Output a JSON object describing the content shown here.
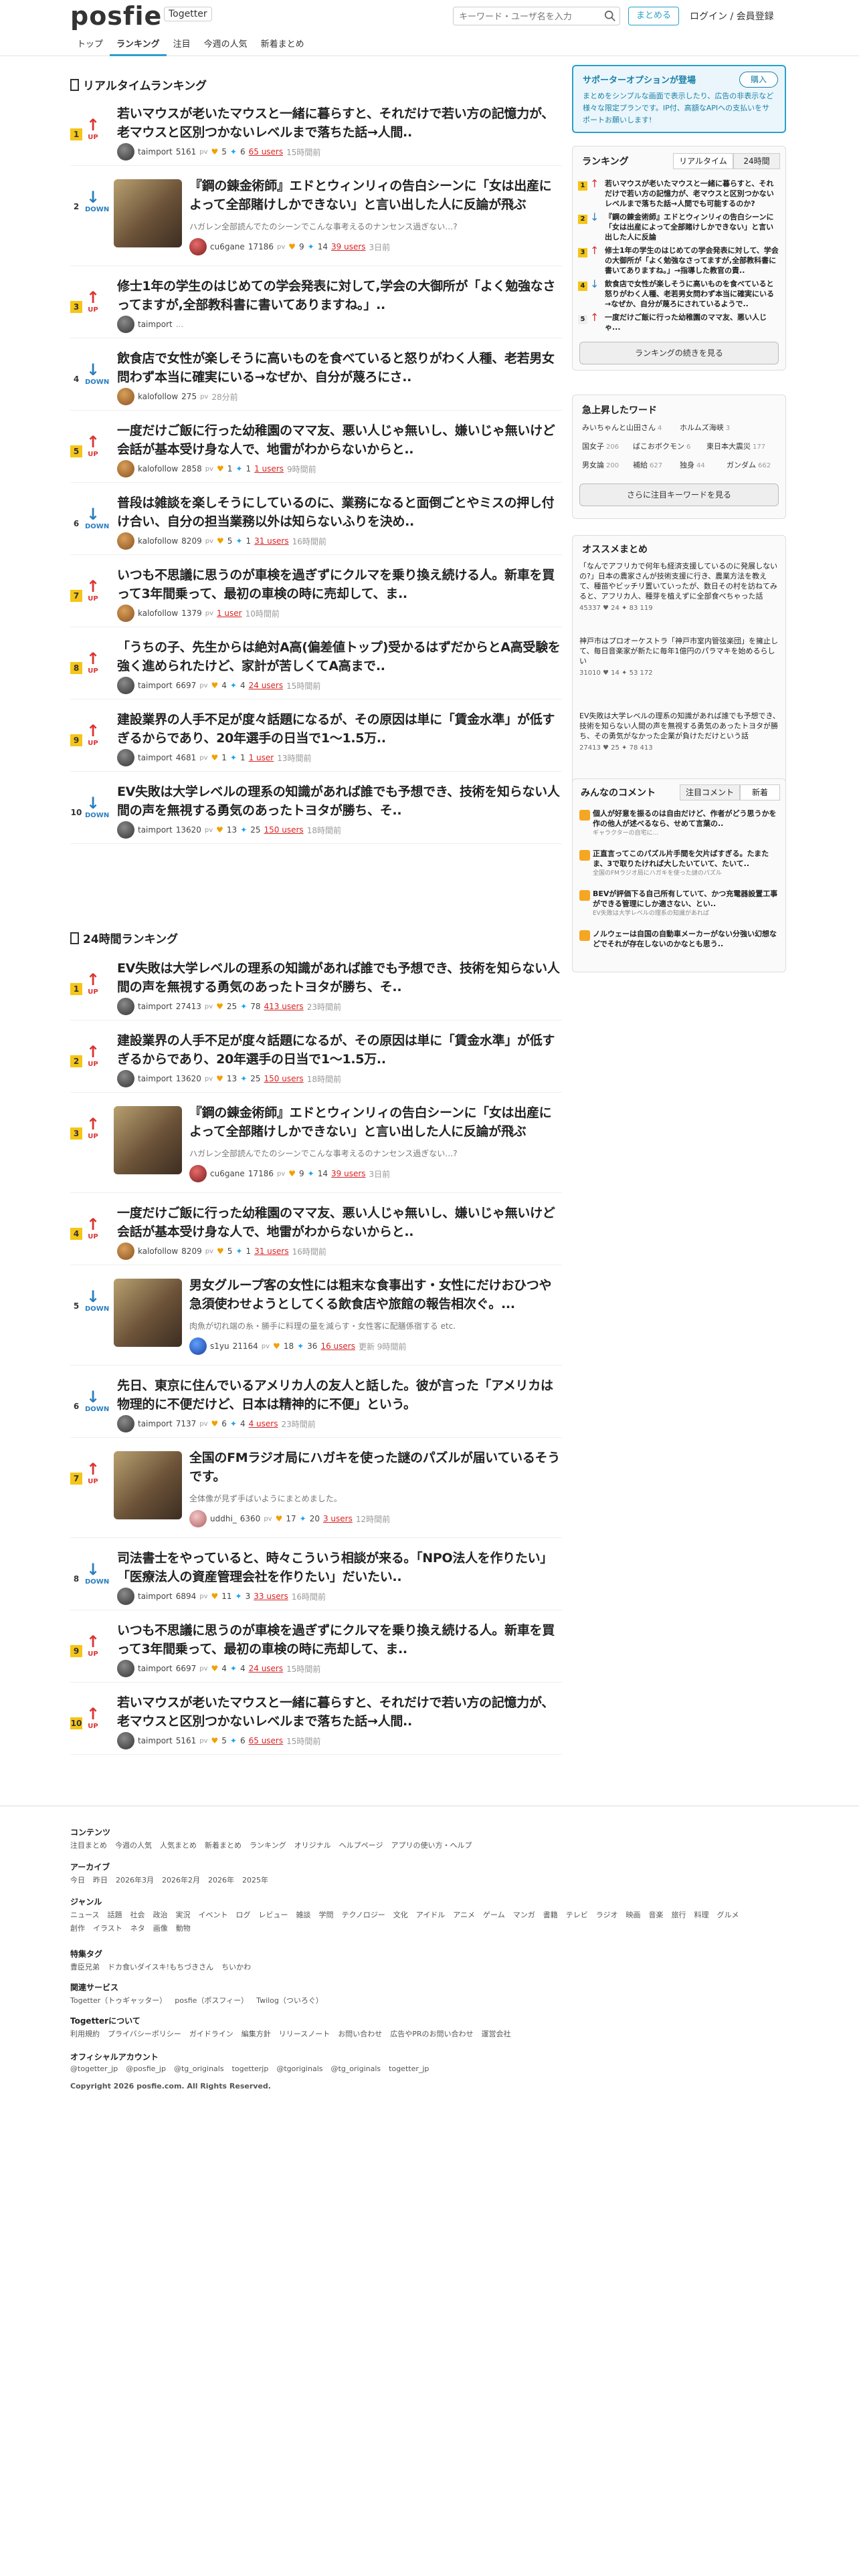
{
  "header": {
    "logo": "posfie",
    "togetter": "Togetter",
    "search_placeholder": "キーワード・ユーザ名を入力",
    "matome": "まとめる",
    "login": "ログイン / 会員登録"
  },
  "nav": [
    "トップ",
    "ランキング",
    "注目",
    "今週の人気",
    "新着まとめ"
  ],
  "realtime": {
    "title": "リアルタイムランキング",
    "items": [
      {
        "rank": "1",
        "dir": "UP",
        "title": "若いマウスが老いたマウスと一緒に暮らすと、それだけで若い方の記憶力が、老マウスと区別つかないレベルまで落ちた話→人間..",
        "user": "taimport",
        "score": "5161",
        "hearts": "5",
        "tweets": "6",
        "users": "65 users",
        "time": "15時間前"
      },
      {
        "rank": "2",
        "dir": "DOWN",
        "title": "『鋼の錬金術師』エドとウィンリィの告白シーンに「女は出産によって全部賭けしかできない」と言い出した人に反論が飛ぶ",
        "desc": "ハガレン全部読んでたのシーンでこんな事考えるのナンセンス過ぎない…?",
        "user": "cu6gane",
        "score": "17186",
        "hearts": "9",
        "tweets": "14",
        "users": "39 users",
        "time": "3日前",
        "thumb": true
      },
      {
        "rank": "3",
        "dir": "UP",
        "title": "修士1年の学生のはじめての学会発表に対して,学会の大御所が「よく勉強なさってますが,全部教科書に書いてありますね。」..",
        "user": "taimport",
        "score": "",
        "time": "..."
      },
      {
        "rank": "4",
        "dir": "DOWN",
        "title": "飲食店で女性が楽しそうに高いものを食べていると怒りがわく人種、老若男女問わず本当に確実にいる→なぜか、自分が蔑ろにさ..",
        "user": "kalofollow",
        "score": "275",
        "time": "28分前"
      },
      {
        "rank": "5",
        "dir": "UP",
        "title": "一度だけご飯に行った幼稚園のママ友、悪い人じゃ無いし、嫌いじゃ無いけど会話が基本受け身な人で、地雷がわからないからと..",
        "user": "kalofollow",
        "score": "2858",
        "hearts": "1",
        "tweets": "1",
        "users": "1 users",
        "time": "9時間前"
      },
      {
        "rank": "6",
        "dir": "DOWN",
        "title": "普段は雑談を楽しそうにしているのに、業務になると面倒ごとやミスの押し付け合い、自分の担当業務以外は知らないふりを決め..",
        "user": "kalofollow",
        "score": "8209",
        "hearts": "5",
        "tweets": "1",
        "users": "31 users",
        "time": "16時間前"
      },
      {
        "rank": "7",
        "dir": "UP",
        "title": "いつも不思議に思うのが車検を過ぎずにクルマを乗り換え続ける人。新車を買って3年間乗って、最初の車検の時に売却して、ま..",
        "user": "kalofollow",
        "score": "1379",
        "users": "1 user",
        "time": "10時間前"
      },
      {
        "rank": "8",
        "dir": "UP",
        "title": "「うちの子、先生からは絶対A高(偏差値トップ)受かるはずだからとA高受験を強く進められたけど、家計が苦しくてA高まで..",
        "user": "taimport",
        "score": "6697",
        "hearts": "4",
        "tweets": "4",
        "users": "24 users",
        "time": "15時間前"
      },
      {
        "rank": "9",
        "dir": "UP",
        "title": "建設業界の人手不足が度々話題になるが、その原因は単に「賃金水準」が低すぎるからであり、20年選手の日当で1〜1.5万..",
        "user": "taimport",
        "score": "4681",
        "hearts": "1",
        "tweets": "1",
        "users": "1 user",
        "time": "13時間前"
      },
      {
        "rank": "10",
        "dir": "DOWN",
        "title": "EV失敗は大学レベルの理系の知識があれば誰でも予想でき、技術を知らない人間の声を無視する勇気のあったトヨタが勝ち、そ..",
        "user": "taimport",
        "score": "13620",
        "hearts": "13",
        "tweets": "25",
        "users": "150 users",
        "time": "18時間前"
      }
    ]
  },
  "daily": {
    "title": "24時間ランキング",
    "items": [
      {
        "rank": "1",
        "dir": "UP",
        "title": "EV失敗は大学レベルの理系の知識があれば誰でも予想でき、技術を知らない人間の声を無視する勇気のあったトヨタが勝ち、そ..",
        "user": "taimport",
        "score": "27413",
        "hearts": "25",
        "tweets": "78",
        "users": "413 users",
        "time": "23時間前"
      },
      {
        "rank": "2",
        "dir": "UP",
        "title": "建設業界の人手不足が度々話題になるが、その原因は単に「賃金水準」が低すぎるからであり、20年選手の日当で1〜1.5万..",
        "user": "taimport",
        "score": "13620",
        "hearts": "13",
        "tweets": "25",
        "users": "150 users",
        "time": "18時間前"
      },
      {
        "rank": "3",
        "dir": "UP",
        "title": "『鋼の錬金術師』エドとウィンリィの告白シーンに「女は出産によって全部賭けしかできない」と言い出した人に反論が飛ぶ",
        "desc": "ハガレン全部読んでたのシーンでこんな事考えるのナンセンス過ぎない…?",
        "user": "cu6gane",
        "score": "17186",
        "hearts": "9",
        "tweets": "14",
        "users": "39 users",
        "time": "3日前",
        "thumb": true
      },
      {
        "rank": "4",
        "dir": "UP",
        "title": "一度だけご飯に行った幼稚園のママ友、悪い人じゃ無いし、嫌いじゃ無いけど会話が基本受け身な人で、地雷がわからないからと..",
        "user": "kalofollow",
        "score": "8209",
        "hearts": "5",
        "tweets": "1",
        "users": "31 users",
        "time": "16時間前"
      },
      {
        "rank": "5",
        "dir": "DOWN",
        "title": "男女グループ客の女性には粗末な食事出す・女性にだけおひつや急須使わせようとしてくる飲食店や旅館の報告相次ぐ。...",
        "desc": "肉魚が切れ端の糸・勝手に料理の量を減らす・女性客に配膳係宿する etc.",
        "user": "s1yu",
        "score": "21164",
        "hearts": "18",
        "tweets": "36",
        "users": "16 users",
        "time": "更新 9時間前",
        "thumb": true
      },
      {
        "rank": "6",
        "dir": "DOWN",
        "title": "先日、東京に住んでいるアメリカ人の友人と話した。彼が言った「アメリカは物理的に不便だけど、日本は精神的に不便」という。",
        "user": "taimport",
        "score": "7137",
        "hearts": "6",
        "tweets": "4",
        "users": "4 users",
        "time": "23時間前"
      },
      {
        "rank": "7",
        "dir": "UP",
        "title": "全国のFMラジオ局にハガキを使った謎のパズルが届いているそうです。",
        "desc": "全体像が見ず手ばいようにまとめました。",
        "user": "uddhi_",
        "score": "6360",
        "hearts": "17",
        "tweets": "20",
        "users": "3 users",
        "time": "12時間前",
        "thumb": true
      },
      {
        "rank": "8",
        "dir": "DOWN",
        "title": "司法書士をやっていると、時々こういう相談が来る。「NPO法人を作りたい」「医療法人の資産管理会社を作りたい」だいたい..",
        "user": "taimport",
        "score": "6894",
        "hearts": "11",
        "tweets": "3",
        "users": "33 users",
        "time": "16時間前"
      },
      {
        "rank": "9",
        "dir": "UP",
        "title": "いつも不思議に思うのが車検を過ぎずにクルマを乗り換え続ける人。新車を買って3年間乗って、最初の車検の時に売却して、ま..",
        "user": "taimport",
        "score": "6697",
        "hearts": "4",
        "tweets": "4",
        "users": "24 users",
        "time": "15時間前"
      },
      {
        "rank": "10",
        "dir": "UP",
        "title": "若いマウスが老いたマウスと一緒に暮らすと、それだけで若い方の記憶力が、老マウスと区別つかないレベルまで落ちた話→人間..",
        "user": "taimport",
        "score": "5161",
        "hearts": "5",
        "tweets": "6",
        "users": "65 users",
        "time": "15時間前"
      }
    ]
  },
  "sidebar": {
    "support": {
      "title": "サポーターオプションが登場",
      "buy": "購入",
      "body": "まとめをシンプルな画面で表示したり、広告の非表示など様々な限定プランです。IP付、高額なAPIへの支払いをサポートお願いします!"
    },
    "ranking": {
      "title": "ランキング",
      "tab1": "リアルタイム",
      "tab2": "24時間",
      "items": [
        "若いマウスが老いたマウスと一緒に暮らすと、それだけで若い方の記憶力が、老マウスと区別つかないレベルまで落ちた話→人間でも可能するのか?",
        "『鋼の錬金術師』エドとウィンリィの告白シーンに「女は出産によって全部賭けしかできない」と言い出した人に反論",
        "修士1年の学生のはじめての学会発表に対して、学会の大御所が「よく勉強なさってますが,全部教科書に書いてありますね。」→指導した教官の責..",
        "飲食店で女性が楽しそうに高いものを食べていると怒りがわく人種、老若男女問わず本当に確実にいる→なぜか、自分が蔑ろにされているようで..",
        "一度だけご飯に行った幼稚園のママ友、悪い人じゃ..."
      ],
      "more": "ランキングの続きを見る"
    },
    "words": {
      "title": "急上昇したワード",
      "items": [
        {
          "w": "みいちゃんと山田さん",
          "c": "4"
        },
        {
          "w": "ホルムズ海峡",
          "c": "3"
        },
        {
          "w": "国女子",
          "c": "206"
        },
        {
          "w": "ばこおボクモン",
          "c": "6"
        },
        {
          "w": "東日本大震災",
          "c": "177"
        },
        {
          "w": "男女論",
          "c": "200"
        },
        {
          "w": "補給",
          "c": "627"
        },
        {
          "w": "独身",
          "c": "44"
        },
        {
          "w": "ガンダム",
          "c": "662"
        }
      ],
      "more": "さらに注目キーワードを見る"
    },
    "osusume": {
      "title": "オススメまとめ",
      "items": [
        {
          "t": "「なんでアフリカで何年も経済支援しているのに発展しないの?」日本の農家さんが技術支援に行き、農業方法を教えて、種苗やビッチリ置いていったが、数日その村を訪ねてみると、アフリカ人、種芽を植えずに全部食べちゃった話",
          "m": "45337 ♥ 24 ✦ 83 119"
        },
        {
          "t": "神戸市はプロオーケストラ「神戸市室内管弦楽団」を擁止して、毎日音楽家が新たに毎年1億円のパラマキを始めるらしい",
          "m": "31010 ♥ 14 ✦ 53 172"
        },
        {
          "t": "EV失敗は大学レベルの理系の知識があれば誰でも予想でき、技術を知らない人間の声を無視する勇気のあったトヨタが勝ち、その勇気がなかった企業が負けただけという話",
          "m": "27413 ♥ 25 ✦ 78 413"
        }
      ]
    },
    "comments": {
      "title": "みんなのコメント",
      "tab1": "注目コメント",
      "tab2": "新着",
      "items": [
        {
          "t": "個人が好意を振るのは自由だけど、作者がどう思うかを作の他人が述べるなら、せめて言葉の..",
          "s": "ギャラクターの自宅に..."
        },
        {
          "t": "正直言ってこのパズル片手間を欠片ばすぎる。たまたま、3で取りたければ大したいていて、たいて..",
          "s": "全国のFMラジオ局にハガキを使った謎のパズル"
        },
        {
          "t": "BEVが評価下る自己所有していて、かつ充電器設置工事ができる管理にしか適さない、とい..",
          "s": "EV失敗は大学レベルの理系の知識があれば"
        },
        {
          "t": "ノルウェーは自国の自動車メーカーがない分強い幻想などでそれが存在しないのかなとも思う..",
          "s": ""
        }
      ]
    }
  },
  "footer": {
    "contents": {
      "h": "コンテンツ",
      "l": [
        "注目まとめ",
        "今週の人気",
        "人気まとめ",
        "新着まとめ",
        "ランキング",
        "オリジナル",
        "ヘルプページ",
        "アプリの使い方・ヘルプ"
      ]
    },
    "archive": {
      "h": "アーカイブ",
      "l": [
        "今日",
        "昨日",
        "2026年3月",
        "2026年2月",
        "2026年",
        "2025年"
      ]
    },
    "genre": {
      "h": "ジャンル",
      "l": [
        "ニュース",
        "話題",
        "社会",
        "政治",
        "実況",
        "イベント",
        "ログ",
        "レビュー",
        "雑談",
        "学問",
        "テクノロジー",
        "文化",
        "アイドル",
        "アニメ",
        "ゲーム",
        "マンガ",
        "書籍",
        "テレビ",
        "ラジオ",
        "映画",
        "音楽",
        "旅行",
        "料理",
        "グルメ",
        "創作",
        "イラスト",
        "ネタ",
        "画像",
        "動物"
      ]
    },
    "tags": {
      "h": "特集タグ",
      "l": [
        "豊臣兄弟",
        "ドカ食いダイスキ!もちづきさん",
        "ちいかわ"
      ]
    },
    "services": {
      "h": "関連サービス",
      "l": [
        "Togetter（トゥギャッター）",
        "posfie（ポスフィー）",
        "Twilog（ついろぐ）"
      ]
    },
    "about": {
      "h": "Togetterについて",
      "l": [
        "利用規約",
        "プライバシーポリシー",
        "ガイドライン",
        "編集方針",
        "リリースノート",
        "お問い合わせ",
        "広告やPRのお問い合わせ",
        "運営会社"
      ]
    },
    "official": {
      "h": "オフィシャルアカウント",
      "l": [
        "@togetter_jp",
        "@posfie_jp",
        "@tg_originals",
        "togetterjp",
        "@tgoriginals",
        "@tg_originals",
        "togetter_jp"
      ]
    },
    "copyright": "Copyright 2026 posfie.com. All Rights Reserved."
  }
}
